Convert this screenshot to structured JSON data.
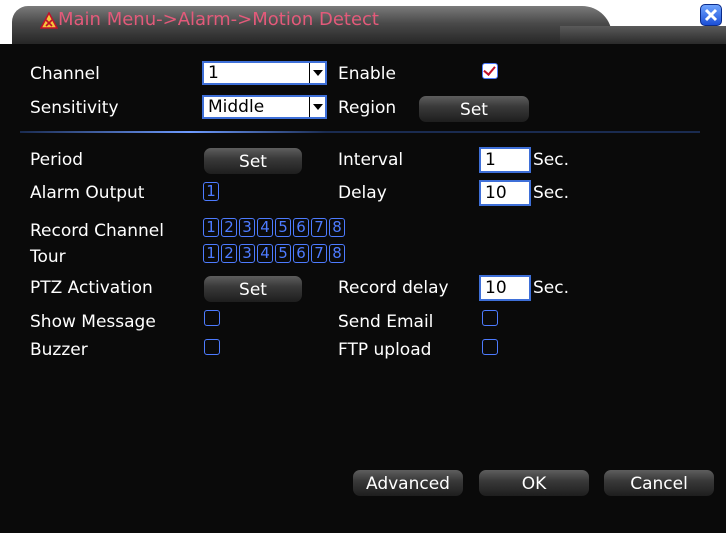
{
  "title": "Main Menu->Alarm->Motion Detect",
  "labels": {
    "channel": "Channel",
    "enable": "Enable",
    "sensitivity": "Sensitivity",
    "region": "Region",
    "period": "Period",
    "interval": "Interval",
    "alarm_output": "Alarm Output",
    "delay": "Delay",
    "record_channel": "Record Channel",
    "tour": "Tour",
    "ptz_activation": "PTZ Activation",
    "record_delay": "Record delay",
    "show_message": "Show Message",
    "send_email": "Send Email",
    "buzzer": "Buzzer",
    "ftp_upload": "FTP upload",
    "sec": "Sec."
  },
  "fields": {
    "channel_value": "1",
    "sensitivity_value": "Middle",
    "interval_value": "1",
    "delay_value": "10",
    "record_delay_value": "10"
  },
  "buttons": {
    "set": "Set",
    "advanced": "Advanced",
    "ok": "OK",
    "cancel": "Cancel"
  },
  "alarm_output": [
    "1"
  ],
  "record_channels": [
    "1",
    "2",
    "3",
    "4",
    "5",
    "6",
    "7",
    "8"
  ],
  "tour_channels": [
    "1",
    "2",
    "3",
    "4",
    "5",
    "6",
    "7",
    "8"
  ],
  "checkboxes": {
    "enable": true,
    "show_message": false,
    "send_email": false,
    "buzzer": false,
    "ftp_upload": false
  },
  "icons": {
    "title": "warning-triangle-icon",
    "close": "close-icon"
  },
  "colors": {
    "accent": "#3e6fd8",
    "title_text": "#e35a7a",
    "background": "#0a0a0a"
  }
}
